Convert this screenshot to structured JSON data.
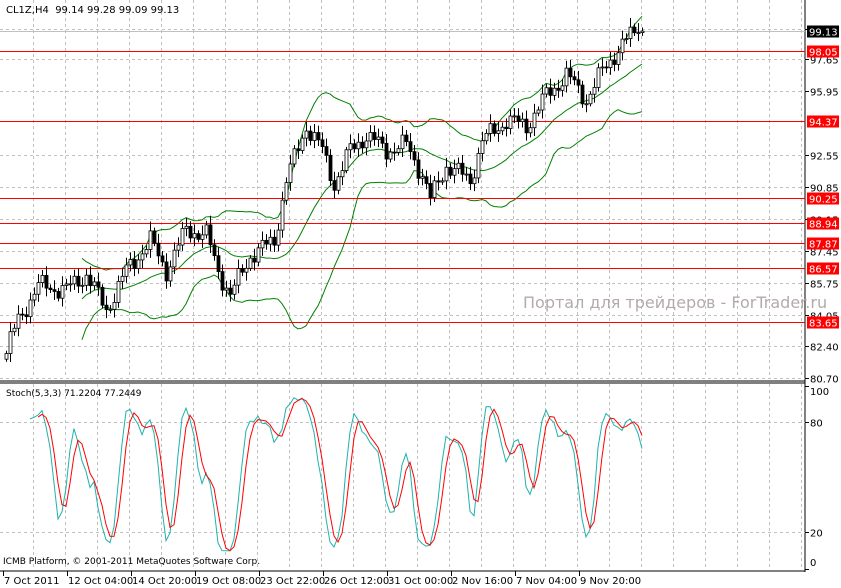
{
  "header": {
    "symbol": "CL1Z,H4",
    "ohlc": "99.14 99.28 99.09 99.13"
  },
  "stoch_header": "Stoch(5,3,3) 71.2204 77.2449",
  "copyright": "ICMB Platform, © 2001-2011 MetaQuotes Software Corp.",
  "watermark": "Портал для трейдеров - ForTrader.ru",
  "colors": {
    "level": "#ff0000",
    "main_stoch": "#20b2aa",
    "signal_stoch": "#ff0000",
    "bands": "#008000",
    "bid_label_bg": "#000000"
  },
  "chart_data": {
    "type": "candlestick",
    "symbol": "CL1Z",
    "timeframe": "H4",
    "bars": 160,
    "trend_keypoints": [
      [
        0,
        82.0
      ],
      [
        1,
        82.7
      ],
      [
        3,
        83.8
      ],
      [
        8,
        85.6
      ],
      [
        15,
        85.4
      ],
      [
        20,
        86.2
      ],
      [
        25,
        84.3
      ],
      [
        30,
        86.4
      ],
      [
        36,
        88.0
      ],
      [
        40,
        86.4
      ],
      [
        45,
        88.6
      ],
      [
        50,
        88.3
      ],
      [
        53,
        86.4
      ],
      [
        56,
        85.1
      ],
      [
        61,
        87.2
      ],
      [
        67,
        88.0
      ],
      [
        70,
        91.2
      ],
      [
        75,
        94.1
      ],
      [
        79,
        92.8
      ],
      [
        82,
        91.0
      ],
      [
        86,
        92.8
      ],
      [
        90,
        93.6
      ],
      [
        95,
        92.8
      ],
      [
        100,
        93.1
      ],
      [
        104,
        91.5
      ],
      [
        106,
        90.2
      ],
      [
        110,
        92.0
      ],
      [
        116,
        91.2
      ],
      [
        119,
        93.3
      ],
      [
        125,
        94.4
      ],
      [
        130,
        94.1
      ],
      [
        135,
        95.7
      ],
      [
        140,
        96.8
      ],
      [
        145,
        95.5
      ],
      [
        149,
        97.0
      ],
      [
        152,
        97.9
      ],
      [
        156,
        98.9
      ],
      [
        159,
        99.13
      ]
    ],
    "price_ticks": [
      "99.25",
      "97.65",
      "95.95",
      "92.55",
      "90.85",
      "89.15",
      "87.45",
      "85.75",
      "84.05",
      "82.40",
      "80.70"
    ],
    "price_range": [
      80.7,
      99.9
    ],
    "levels": [
      {
        "label": "98.05",
        "price": 98.05
      },
      {
        "label": "94.37",
        "price": 94.37
      },
      {
        "label": "90.25",
        "price": 90.25
      },
      {
        "label": "88.94",
        "price": 88.94
      },
      {
        "label": "87.87",
        "price": 87.87
      },
      {
        "label": "86.57",
        "price": 86.57
      },
      {
        "label": "83.65",
        "price": 83.65
      }
    ],
    "bid": {
      "label": "99.13",
      "price": 99.13
    },
    "stoch_ticks": [
      "100",
      "80",
      "20",
      "0"
    ],
    "time_labels": [
      "7 Oct 2011",
      "12 Oct 04:00",
      "14 Oct 20:00",
      "19 Oct 08:00",
      "23 Oct 22:00",
      "26 Oct 12:00",
      "31 Oct 00:00",
      "2 Nov 16:00",
      "7 Nov 04:00",
      "9 Nov 20:00"
    ],
    "indicators": [
      "Bollinger Bands(20,2)",
      "Stochastic(5,3,3)"
    ]
  }
}
